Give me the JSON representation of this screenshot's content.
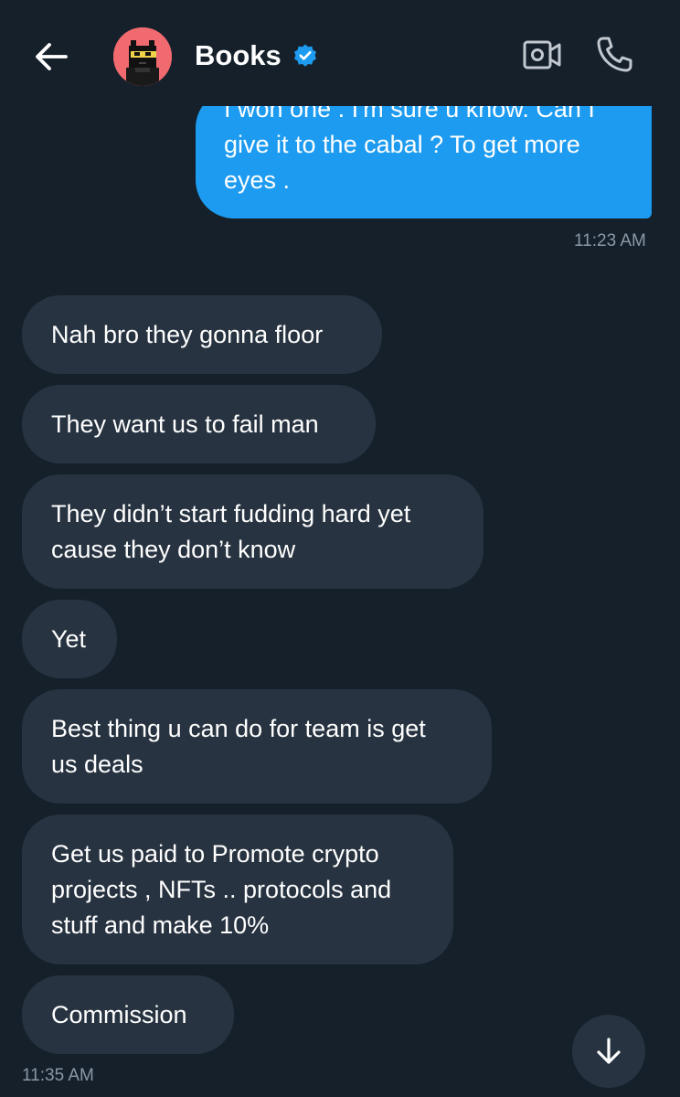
{
  "header": {
    "title": "Books",
    "back_icon": "arrow-left-icon",
    "verified_icon": "verified-badge-icon",
    "video_icon": "video-camera-icon",
    "call_icon": "phone-icon"
  },
  "colors": {
    "background": "#15202b",
    "sent_bubble": "#1d9bf0",
    "received_bubble": "#273340",
    "timestamp": "#8b98a5",
    "avatar_bg": "#f06a6f"
  },
  "messages": {
    "sent": [
      {
        "text": "I won one . I'm sure u know. Can I\ngive it to the cabal ? To get more\neyes .",
        "time": "11:23 AM"
      }
    ],
    "received": [
      {
        "text": "Nah bro they gonna floor"
      },
      {
        "text": "They want us to fail man"
      },
      {
        "text": "They didn’t start fudding hard yet\ncause they don’t know"
      },
      {
        "text": "Yet"
      },
      {
        "text": "Best thing u can do for team is get\nus deals"
      },
      {
        "text": "Get us paid to Promote crypto\nprojects , NFTs .. protocols and\nstuff and make 10%"
      },
      {
        "text": "Commission"
      }
    ],
    "received_time": "11:35 AM"
  },
  "scroll_button": {
    "icon": "arrow-down-icon"
  }
}
